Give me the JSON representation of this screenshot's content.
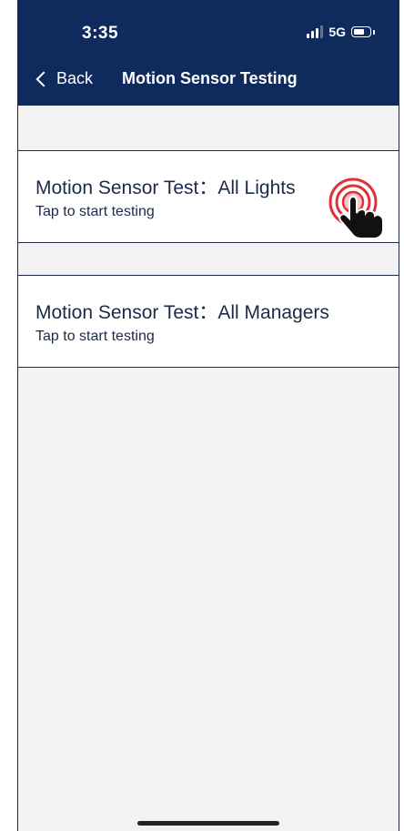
{
  "status_bar": {
    "time": "3:35",
    "network": "5G"
  },
  "nav": {
    "back_label": "Back",
    "title": "Motion Sensor Testing"
  },
  "items": [
    {
      "title": "Motion Sensor Test：All Lights",
      "subtitle": "Tap to start testing"
    },
    {
      "title": "Motion Sensor Test：All Managers",
      "subtitle": "Tap to start testing"
    }
  ],
  "colors": {
    "header": "#0f2a5c",
    "background": "#f2f2f2",
    "text": "#1c2a4a",
    "tap_ring": "#e0303a"
  },
  "icons": {
    "tap_gesture": "hand-tap-icon",
    "back": "chevron-left-icon"
  }
}
